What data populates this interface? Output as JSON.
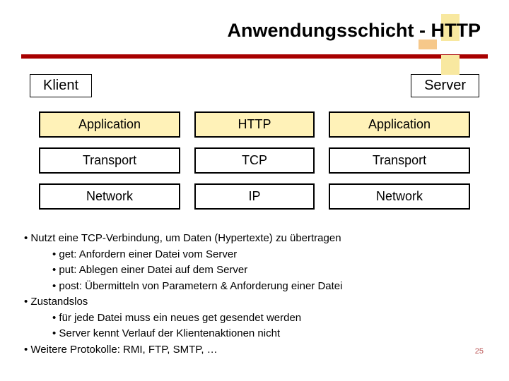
{
  "title": "Anwendungsschicht  -  HTTP",
  "label_left": "Klient",
  "label_right": "Server",
  "grid": {
    "r0c0": "Application",
    "r0c1": "HTTP",
    "r0c2": "Application",
    "r1c0": "Transport",
    "r1c1": "TCP",
    "r1c2": "Transport",
    "r2c0": "Network",
    "r2c1": "IP",
    "r2c2": "Network"
  },
  "bullets": {
    "a": "Nutzt eine TCP-Verbindung, um Daten (Hypertexte) zu übertragen",
    "a1": "get: Anfordern einer Datei vom Server",
    "a2": "put: Ablegen einer Datei auf dem Server",
    "a3": "post: Übermitteln von Parametern & Anforderung einer Datei",
    "b": "Zustandslos",
    "b1": "für jede Datei muss ein neues get gesendet werden",
    "b2": "Server kennt Verlauf der Klientenaktionen nicht",
    "c": "Weitere Protokolle: RMI, FTP, SMTP, …"
  },
  "slidenum": "25"
}
